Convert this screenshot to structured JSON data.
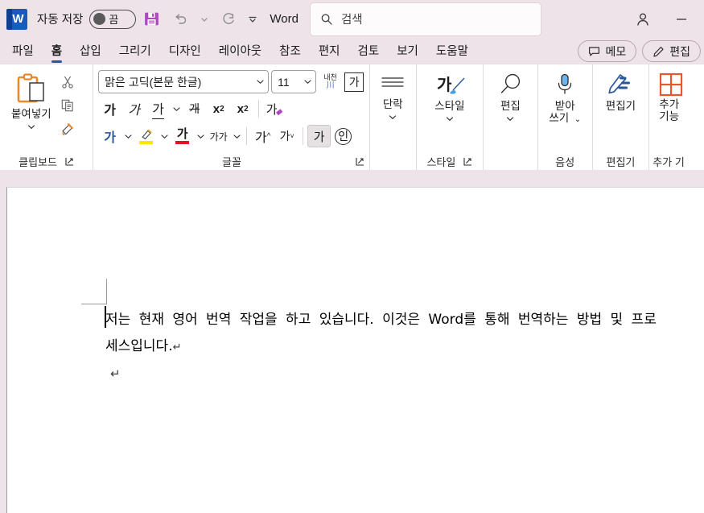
{
  "titlebar": {
    "logo_text": "W",
    "autosave_label": "자동 저장",
    "autosave_state": "끔",
    "save_tooltip": "저장",
    "undo_tooltip": "실행 취소",
    "redo_tooltip": "다시 실행",
    "customize_tooltip": "빠른 실행 도구 모음 사용자 지정",
    "app_name": "Word",
    "account_tooltip": "계정",
    "minimize_tooltip": "최소화"
  },
  "search": {
    "placeholder": "검색",
    "icon": "search-icon"
  },
  "tabs": [
    {
      "label": "파일",
      "active": false
    },
    {
      "label": "홈",
      "active": true
    },
    {
      "label": "삽입",
      "active": false
    },
    {
      "label": "그리기",
      "active": false
    },
    {
      "label": "디자인",
      "active": false
    },
    {
      "label": "레이아웃",
      "active": false
    },
    {
      "label": "참조",
      "active": false
    },
    {
      "label": "편지",
      "active": false
    },
    {
      "label": "검토",
      "active": false
    },
    {
      "label": "보기",
      "active": false
    },
    {
      "label": "도움말",
      "active": false
    }
  ],
  "tab_actions": {
    "comments_label": "메모",
    "editing_label": "편집"
  },
  "ribbon": {
    "clipboard": {
      "group_label": "클립보드",
      "paste_label": "붙여넣기",
      "cut_tooltip": "잘라내기",
      "copy_tooltip": "복사",
      "format_painter_tooltip": "서식 복사"
    },
    "font": {
      "group_label": "글꼴",
      "font_name": "맑은 고딕(본문 한글)",
      "font_size": "11",
      "phonetic_guide_top": "내천",
      "phonetic_guide_bottom": "川",
      "char_border_label": "가",
      "bold_label": "가",
      "italic_label": "가",
      "underline_label": "가",
      "strikethrough_label": "개",
      "subscript_label": "x",
      "subscript_sub": "2",
      "superscript_label": "x",
      "superscript_sup": "2",
      "clear_format_label": "가",
      "text_effects_label": "가",
      "highlight_label": "",
      "font_color_label": "가",
      "char_shading_label": "가가",
      "grow_font_label": "가",
      "shrink_font_label": "가",
      "char_shading2_label": "가",
      "enclose_char_label": "인",
      "highlight_color": "#FFE600",
      "font_color": "#E81123",
      "text_effect_color": "#2B579A"
    },
    "paragraph": {
      "group_label": "",
      "label": "단락"
    },
    "styles": {
      "group_label": "스타일",
      "label": "스타일"
    },
    "editing": {
      "label": "편집"
    },
    "voice": {
      "group_label": "음성",
      "label_line1": "받아",
      "label_line2": "쓰기"
    },
    "editor": {
      "group_label": "편집기",
      "label": "편집기"
    },
    "addins": {
      "group_label": "추가 기",
      "label_line1": "추가",
      "label_line2": "기능"
    }
  },
  "document": {
    "body_text": "저는 현재 영어 번역 작업을 하고 있습니다. 이것은 Word를 통해 번역하는 방법 및 프로세스입니다.",
    "paragraph_mark": "↵",
    "empty_paragraph_mark": "↵"
  },
  "colors": {
    "window_background": "#EDE3E9",
    "ribbon_background": "#FFFFFF",
    "accent": "#2B579A",
    "word_blue": "#185ABD",
    "page_background": "#FFFFFF"
  }
}
